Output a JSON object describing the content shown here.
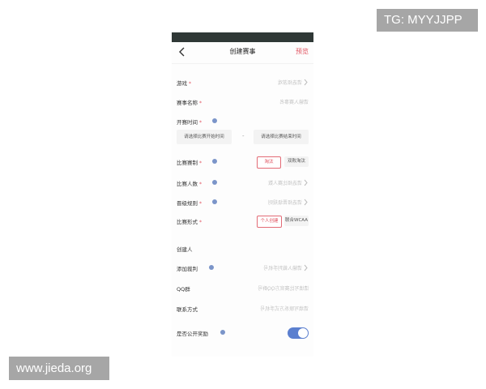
{
  "watermarks": {
    "top_right": "TG: MYYJJPP",
    "bottom_left": "www.jieda.org"
  },
  "nav": {
    "title": "创建赛事",
    "preview": "预览"
  },
  "form": {
    "game": {
      "label": "游戏",
      "required": "*",
      "placeholder": "请选择游戏"
    },
    "name": {
      "label": "赛事名称",
      "required": "*",
      "placeholder": "请输入赛事名"
    },
    "time": {
      "label": "开赛时间",
      "required": "*",
      "start": "请选择比赛开始时间",
      "dash": "-",
      "end": "请选择比赛结束时间"
    },
    "format": {
      "label": "比赛赛制",
      "required": "*",
      "options": [
        "淘汰",
        "双败淘汰"
      ]
    },
    "players": {
      "label": "比赛人数",
      "required": "*",
      "placeholder": "请选择比赛人数"
    },
    "advance": {
      "label": "晋级规则",
      "required": "*",
      "placeholder": "请选择晋级规则"
    },
    "mode": {
      "label": "比赛形式",
      "required": "*",
      "options": [
        "个人创建",
        "联合WCAA"
      ]
    },
    "creator": {
      "label": "创建人"
    },
    "referee": {
      "label": "添加裁判",
      "placeholder": "请输入裁判手机号"
    },
    "qq": {
      "label": "QQ群",
      "placeholder": "请填写比赛官方QQ群号"
    },
    "contact": {
      "label": "联系方式",
      "placeholder": "请填写联系方式手机号"
    },
    "reward": {
      "label": "是否公开奖励",
      "enabled": true
    }
  },
  "colors": {
    "accent": "#e0525f",
    "toggle": "#5b7fcf",
    "info": "#7b95c9",
    "statusbar": "#2f3836"
  }
}
